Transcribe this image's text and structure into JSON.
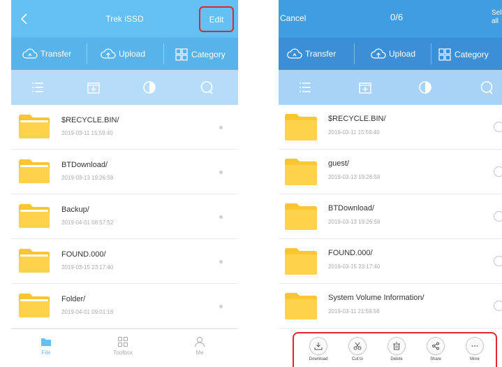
{
  "left": {
    "title": "Trek iSSD",
    "edit_label": "Edit",
    "actions": {
      "transfer": "Transfer",
      "upload": "Upload",
      "category": "Category"
    },
    "files": [
      {
        "name": "$RECYCLE.BIN/",
        "date": "2019-03-11 15:59:40"
      },
      {
        "name": "BTDownload/",
        "date": "2019-03-13 19:26:58"
      },
      {
        "name": "Backup/",
        "date": "2019-04-01 08:57:52"
      },
      {
        "name": "FOUND.000/",
        "date": "2019-03-15 23:17:40"
      },
      {
        "name": "Folder/",
        "date": "2019-04-01 09:01:16"
      }
    ],
    "tabs": {
      "file": "File",
      "toolbox": "Toolbox",
      "me": "Me"
    }
  },
  "right": {
    "cancel_label": "Cancel",
    "selection_count": "0/6",
    "select_all_label": "Select all",
    "actions": {
      "transfer": "Transfer",
      "upload": "Upload",
      "category": "Category"
    },
    "files": [
      {
        "name": "$RECYCLE.BIN/",
        "date": "2019-03-11 15:59:40"
      },
      {
        "name": "guest/",
        "date": "2019-03-13 19:26:58"
      },
      {
        "name": "BTDownload/",
        "date": "2019-03-13 19:26:58"
      },
      {
        "name": "FOUND.000/",
        "date": "2019-03-15 23:17:40"
      },
      {
        "name": "System Volume Information/",
        "date": "2019-03-11 21:59:56"
      }
    ],
    "bottom_actions": {
      "download": "Download",
      "cut": "Cut to",
      "delete": "Delete",
      "share": "Share",
      "more": "More"
    }
  },
  "colors": {
    "left_header": "#64c0f2",
    "right_header": "#3f9ee2",
    "folder": "#fbc531",
    "highlight": "#e3252e"
  }
}
